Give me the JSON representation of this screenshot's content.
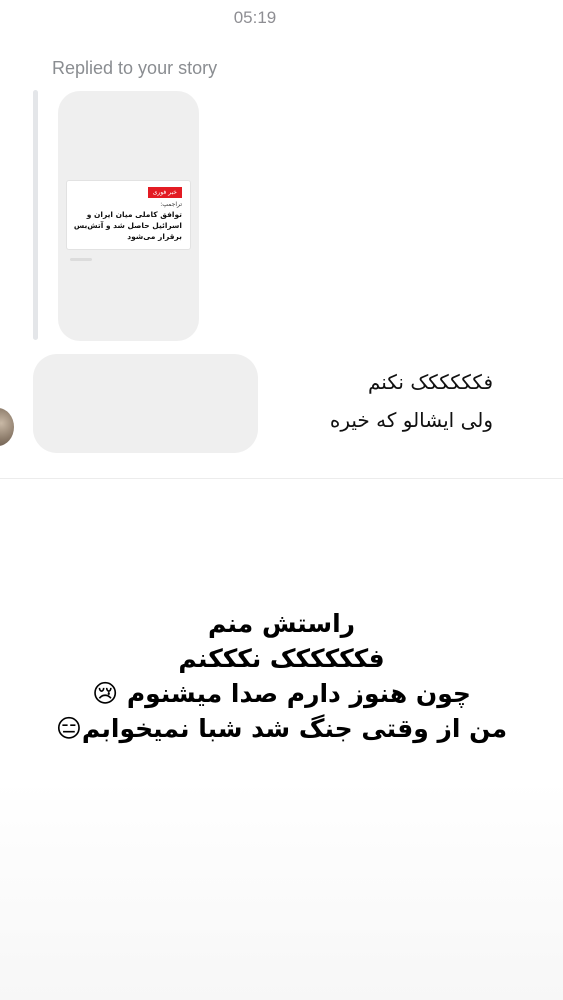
{
  "header": {
    "timestamp": "05:19"
  },
  "reply": {
    "label": "Replied to your story",
    "story": {
      "badge": "خبر فوری",
      "subtitle": "تراجمپ:",
      "headline": "توافق کاملی میان ایران و اسرائیل حاصل شد و آتش‌بس برقرار می‌شود"
    }
  },
  "message": {
    "lines": [
      "فکککککک نکنم",
      "ولی ایشالو که خیره"
    ]
  },
  "overlay": {
    "lines": [
      "راستش منم",
      "فکککککک نکککنم",
      "چون هنوز دارم صدا میشنوم 😢",
      "من از وقتی جنگ شد شبا نمیخوابم😑"
    ]
  },
  "colors": {
    "bubble": "#efefef",
    "badge": "#e31b23",
    "meta_text": "#8a8d91"
  }
}
